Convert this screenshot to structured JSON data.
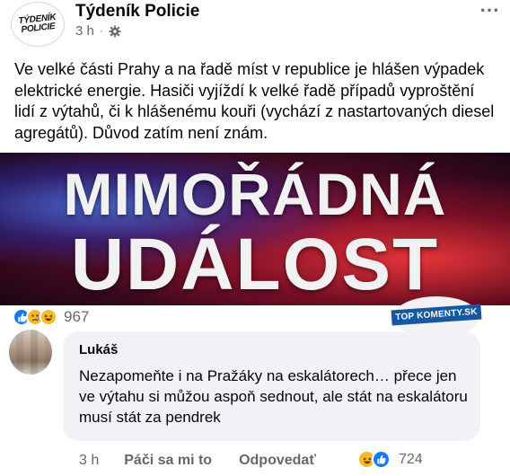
{
  "post": {
    "page_name": "Týdeník Policie",
    "avatar_logo": [
      "TÝDENÍK",
      "POLICIE"
    ],
    "time": "3 h",
    "meta_separator": "·",
    "more_icon": "⋯",
    "text": "Ve velké části Prahy a na řadě míst v republice je hlášen výpadek elektrické energie. Hasiči vyjíždí k velké řadě případů vyproštění lidí z výtahů, či k hlášenému kouři (vychází z nastartovaných diesel agregátů). Důvod zatím není znám.",
    "banner": {
      "line1": "MIMOŘÁDNÁ",
      "line2": "UDÁLOST"
    },
    "reaction_count": "967"
  },
  "watermark": {
    "text": "TOP KOMENTY.SK"
  },
  "comment": {
    "author": "Lukáš",
    "text": "Nezapomeňte i na Pražáky na eskalátorech… přece jen ve výtahu si můžou aspoň sednout, ale stát na eskalátoru musí stát za pendrek",
    "time": "3 h",
    "like_label": "Páči sa mi to",
    "reply_label": "Odpovedať",
    "reaction_count": "724"
  },
  "colors": {
    "link_blue": "#1877f2",
    "secondary_text": "#65676b",
    "bubble_bg": "#f0f2f5",
    "watermark_blue": "#1558a0"
  },
  "icons": [
    "gear-icon",
    "more-icon",
    "like-reaction-icon",
    "sad-reaction-icon",
    "haha-reaction-icon"
  ]
}
